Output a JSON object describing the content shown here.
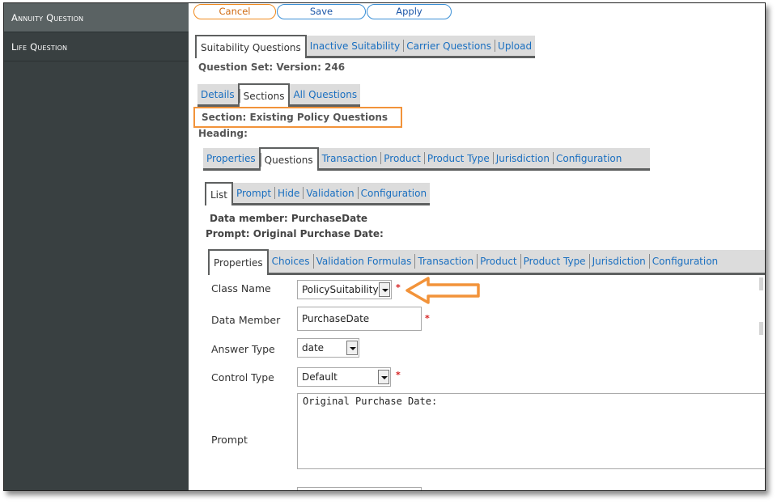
{
  "sidebar": {
    "items": [
      {
        "label": "Annuity Question",
        "active": true
      },
      {
        "label": "Life Question",
        "active": false
      }
    ]
  },
  "toolbar": {
    "cancel_label": "Cancel",
    "save_label": "Save",
    "apply_label": "Apply"
  },
  "top_tabs": [
    "Suitability Questions",
    "Inactive Suitability",
    "Carrier Questions",
    "Upload"
  ],
  "question_set": "Question Set: Version: 246",
  "section_tabs": [
    "Details",
    "Sections",
    "All Questions"
  ],
  "section": {
    "title": "Section: Existing Policy Questions",
    "heading": "Heading:"
  },
  "sub_tabs": [
    "Properties",
    "Questions",
    "Transaction",
    "Product",
    "Product Type",
    "Jurisdiction",
    "Configuration"
  ],
  "list_tabs": [
    "List",
    "Prompt",
    "Hide",
    "Validation",
    "Configuration"
  ],
  "question": {
    "data_member_label": "Data member: PurchaseDate",
    "prompt_label": "Prompt: Original Purchase Date:"
  },
  "detail_tabs": [
    "Properties",
    "Choices",
    "Validation Formulas",
    "Transaction",
    "Product",
    "Product Type",
    "Jurisdiction",
    "Configuration"
  ],
  "form": {
    "class_name": {
      "label": "Class Name",
      "value": "PolicySuitability"
    },
    "data_member": {
      "label": "Data Member",
      "value": "PurchaseDate"
    },
    "answer_type": {
      "label": "Answer Type",
      "value": "date"
    },
    "control_type": {
      "label": "Control Type",
      "value": "Default"
    },
    "prompt": {
      "label": "Prompt",
      "value": "Original Purchase Date:"
    },
    "required_mark": "*"
  },
  "colors": {
    "sidebar_bg": "#394041",
    "sidebar_active": "#5a6263",
    "link": "#1a6fc0",
    "annotation": "#f2933a",
    "required": "#d62020"
  }
}
